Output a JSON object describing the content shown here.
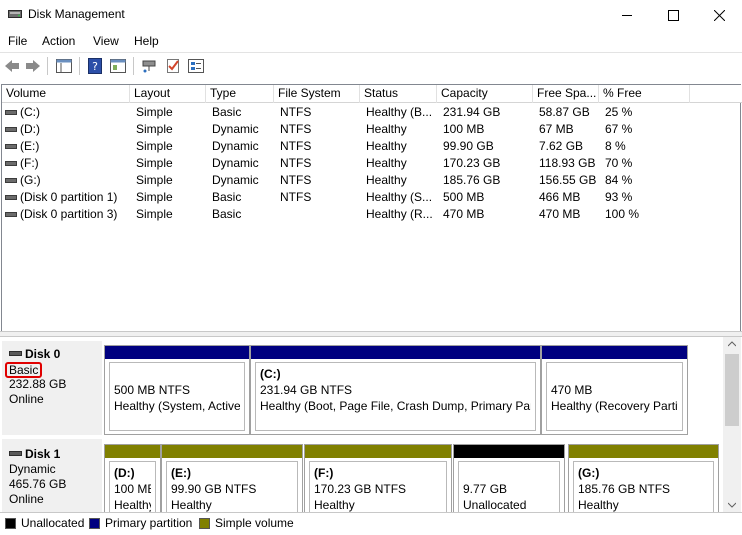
{
  "window": {
    "title": "Disk Management"
  },
  "menu": [
    "File",
    "Action",
    "View",
    "Help"
  ],
  "table": {
    "columns": [
      "Volume",
      "Layout",
      "Type",
      "File System",
      "Status",
      "Capacity",
      "Free Spa...",
      "% Free"
    ],
    "rows": [
      [
        "(C:)",
        "Simple",
        "Basic",
        "NTFS",
        "Healthy (B...",
        "231.94 GB",
        "58.87 GB",
        "25 %"
      ],
      [
        "(D:)",
        "Simple",
        "Dynamic",
        "NTFS",
        "Healthy",
        "100 MB",
        "67 MB",
        "67 %"
      ],
      [
        "(E:)",
        "Simple",
        "Dynamic",
        "NTFS",
        "Healthy",
        "99.90 GB",
        "7.62 GB",
        "8 %"
      ],
      [
        "(F:)",
        "Simple",
        "Dynamic",
        "NTFS",
        "Healthy",
        "170.23 GB",
        "118.93 GB",
        "70 %"
      ],
      [
        "(G:)",
        "Simple",
        "Dynamic",
        "NTFS",
        "Healthy",
        "185.76 GB",
        "156.55 GB",
        "84 %"
      ],
      [
        "(Disk 0 partition 1)",
        "Simple",
        "Basic",
        "NTFS",
        "Healthy (S...",
        "500 MB",
        "466 MB",
        "93 %"
      ],
      [
        "(Disk 0 partition 3)",
        "Simple",
        "Basic",
        "",
        "Healthy (R...",
        "470 MB",
        "470 MB",
        "100 %"
      ]
    ]
  },
  "disks": [
    {
      "name": "Disk 0",
      "type": "Basic",
      "size": "232.88 GB",
      "status": "Online",
      "partitions": [
        {
          "label": "",
          "size": "500 MB NTFS",
          "status": "Healthy (System, Active,",
          "kind": "primary"
        },
        {
          "label": "(C:)",
          "size": "231.94 GB NTFS",
          "status": "Healthy (Boot, Page File, Crash Dump, Primary Partit",
          "kind": "primary"
        },
        {
          "label": "",
          "size": "470 MB",
          "status": "Healthy (Recovery Partiti",
          "kind": "primary"
        }
      ]
    },
    {
      "name": "Disk 1",
      "type": "Dynamic",
      "size": "465.76 GB",
      "status": "Online",
      "partitions": [
        {
          "label": "(D:)",
          "size": "100 MB",
          "status": "Healthy",
          "kind": "simple"
        },
        {
          "label": "(E:)",
          "size": "99.90 GB NTFS",
          "status": "Healthy",
          "kind": "simple"
        },
        {
          "label": "(F:)",
          "size": "170.23 GB NTFS",
          "status": "Healthy",
          "kind": "simple"
        },
        {
          "label": "",
          "size": "9.77 GB",
          "status": "Unallocated",
          "kind": "unallocated"
        },
        {
          "label": "(G:)",
          "size": "185.76 GB NTFS",
          "status": "Healthy",
          "kind": "simple"
        }
      ]
    }
  ],
  "legend": [
    {
      "label": "Unallocated",
      "color": "#000000"
    },
    {
      "label": "Primary partition",
      "color": "#000080"
    },
    {
      "label": "Simple volume",
      "color": "#808000"
    }
  ],
  "colors": {
    "primary": "#000080",
    "simple": "#808000",
    "unallocated": "#000000"
  }
}
